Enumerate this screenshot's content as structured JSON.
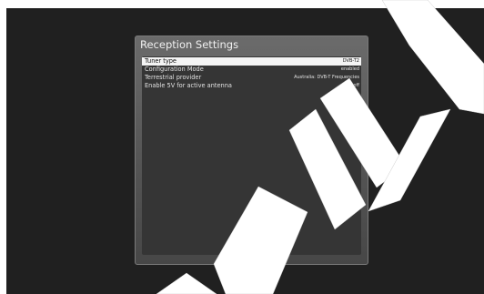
{
  "dialog": {
    "title": "Reception Settings"
  },
  "settings": [
    {
      "label": "Tuner type",
      "value": "DVB-T2",
      "selected": true
    },
    {
      "label": "Configuration Mode",
      "value": "enabled",
      "selected": false
    },
    {
      "label": "Terrestrial provider",
      "value": "Australia: DVB-T Frequencies",
      "selected": false
    },
    {
      "label": "Enable 5V for active antenna",
      "value": "off",
      "selected": false
    }
  ]
}
